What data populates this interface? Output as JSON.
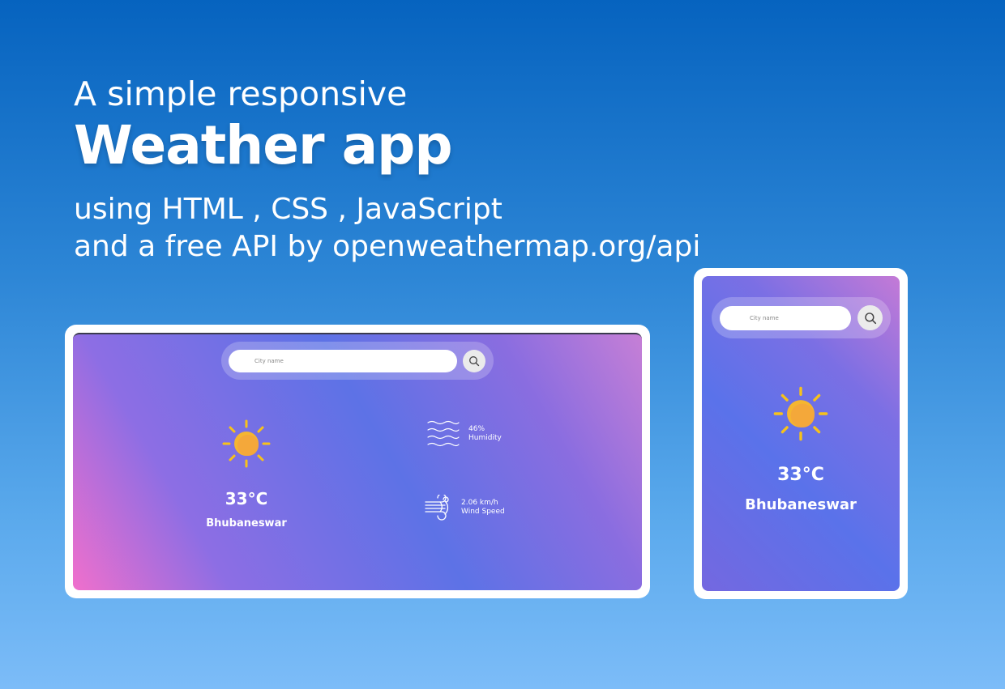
{
  "headline": {
    "line1": "A simple responsive",
    "line2": "Weather app",
    "line3": "using HTML , CSS , JavaScript",
    "line4": "and a free API by openweathermap.org/api"
  },
  "desktop": {
    "search_placeholder": "City name",
    "temperature": "33°C",
    "city": "Bhubaneswar",
    "humidity_value": "46%",
    "humidity_label": "Humidity",
    "wind_value": "2.06 km/h",
    "wind_label": "Wind Speed",
    "weather_icon": "sun-icon"
  },
  "mobile": {
    "search_placeholder": "City name",
    "temperature": "33°C",
    "city": "Bhubaneswar",
    "weather_icon": "sun-icon"
  },
  "colors": {
    "background_top": "#0663bf",
    "background_bottom": "#7cbcf8",
    "sun_rays": "#f7c21a",
    "sun_core": "#f4a83a"
  }
}
